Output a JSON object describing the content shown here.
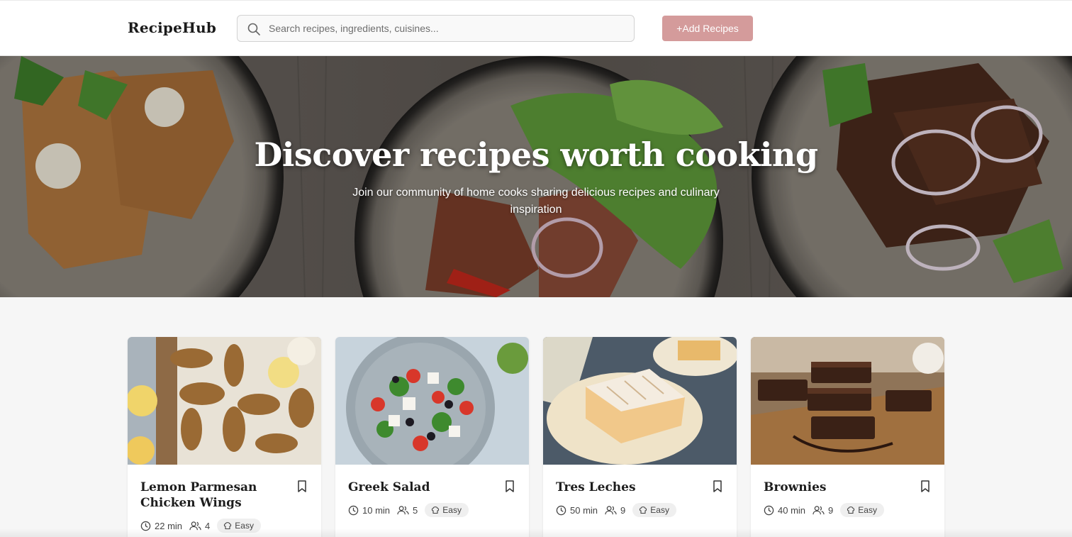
{
  "header": {
    "logo": "RecipeHub",
    "search_placeholder": "Search recipes, ingredients, cuisines...",
    "add_button": "+Add Recipes"
  },
  "hero": {
    "title": "Discover recipes worth cooking",
    "subtitle": "Join our community of home cooks sharing delicious recipes and culinary inspiration"
  },
  "recipes": [
    {
      "title": "Lemon Parmesan Chicken Wings",
      "time": "22 min",
      "servings": "4",
      "difficulty": "Easy"
    },
    {
      "title": "Greek Salad",
      "time": "10 min",
      "servings": "5",
      "difficulty": "Easy"
    },
    {
      "title": "Tres Leches",
      "time": "50 min",
      "servings": "9",
      "difficulty": "Easy"
    },
    {
      "title": "Brownies",
      "time": "40 min",
      "servings": "9",
      "difficulty": "Easy"
    }
  ],
  "colors": {
    "accent": "#d49b9b",
    "page_bg": "#f6f6f6",
    "header_bg": "#ffffff"
  },
  "icons": [
    "search-icon",
    "bookmark-icon",
    "clock-icon",
    "users-icon",
    "chef-hat-icon"
  ]
}
